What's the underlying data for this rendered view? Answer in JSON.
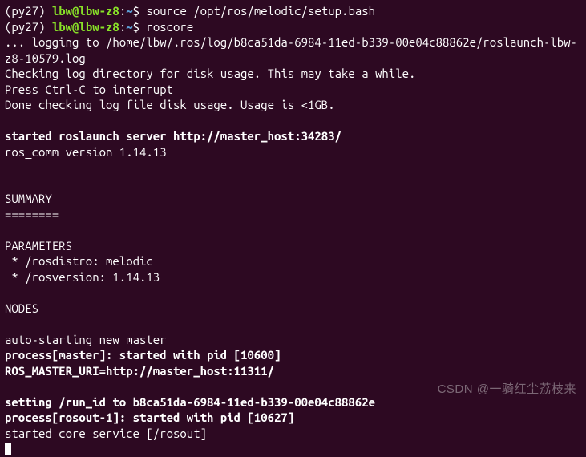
{
  "prompt1": {
    "env": "(py27) ",
    "userhost": "lbw@lbw-z8",
    "colon": ":",
    "path": "~",
    "dollar": "$ ",
    "cmd": "source /opt/ros/melodic/setup.bash"
  },
  "prompt2": {
    "env": "(py27) ",
    "userhost": "lbw@lbw-z8",
    "colon": ":",
    "path": "~",
    "dollar": "$ ",
    "cmd": "roscore"
  },
  "output": {
    "log1": "... logging to /home/lbw/.ros/log/b8ca51da-6984-11ed-b339-00e04c88862e/roslaunch-lbw-z8-10579.log",
    "log2": "Checking log directory for disk usage. This may take a while.",
    "log3": "Press Ctrl-C to interrupt",
    "log4": "Done checking log file disk usage. Usage is <1GB.",
    "blank": "",
    "server": "started roslaunch server http://master_host:34283/",
    "version": "ros_comm version 1.14.13",
    "summary_title": "SUMMARY",
    "summary_sep": "========",
    "params_title": "PARAMETERS",
    "param1": " * /rosdistro: melodic",
    "param2": " * /rosversion: 1.14.13",
    "nodes_title": "NODES",
    "autostart": "auto-starting new master",
    "procmaster": "process[master]: started with pid [10600]",
    "rosmaster": "ROS_MASTER_URI=http://master_host:11311/",
    "runid": "setting /run_id to b8ca51da-6984-11ed-b339-00e04c88862e",
    "procrosout": "process[rosout-1]: started with pid [10627]",
    "coreservice": "started core service [/rosout]"
  },
  "watermark": "CSDN @一骑红尘荔枝来"
}
